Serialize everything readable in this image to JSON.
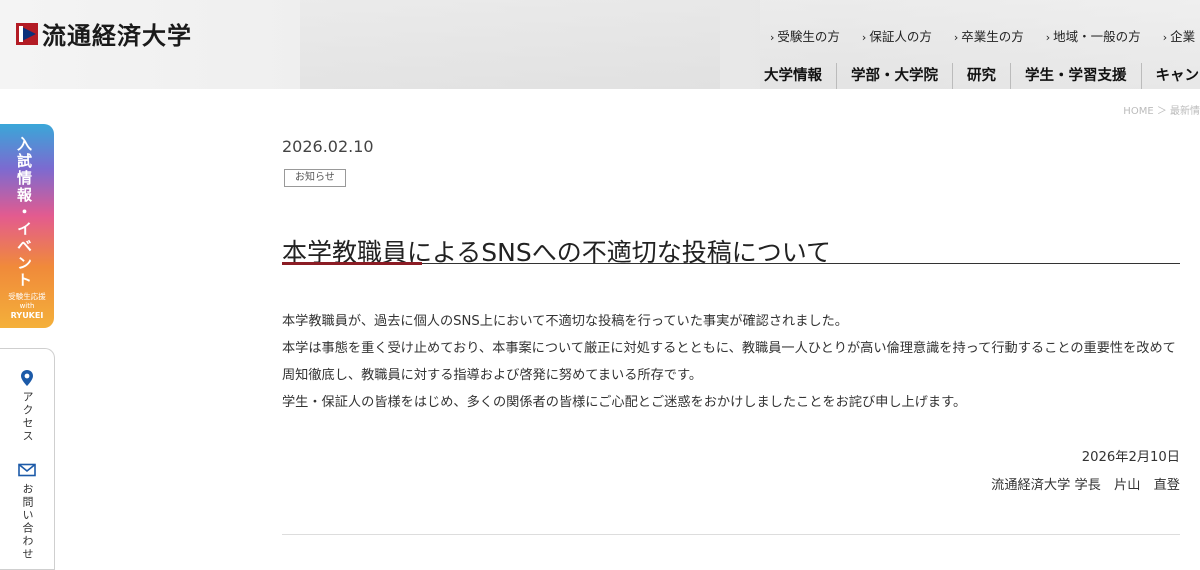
{
  "header": {
    "logo_text": "流通経済大学",
    "top_links": [
      "受験生の方",
      "保証人の方",
      "卒業生の方",
      "地域・一般の方",
      "企業・"
    ],
    "main_nav": [
      "大学情報",
      "学部・大学院",
      "研究",
      "学生・学習支援",
      "キャン"
    ]
  },
  "breadcrumb": "HOME ＞ 最新情",
  "side_tab": {
    "label": "入試情報・イベント",
    "sub_line1": "受験生応援",
    "sub_line2": "with",
    "sub_line3": "RYUKEI"
  },
  "side_panel": {
    "access_icon": "map-pin-icon",
    "access_label": "アクセス",
    "contact_icon": "mail-icon",
    "contact_label": "お問い合わせ"
  },
  "article": {
    "date": "2026.02.10",
    "category": "お知らせ",
    "title": "本学教職員によるSNSへの不適切な投稿について",
    "paragraphs": [
      "本学教職員が、過去に個人のSNS上において不適切な投稿を行っていた事実が確認されました。",
      "本学は事態を重く受け止めており、本事案について厳正に対処するとともに、教職員一人ひとりが高い倫理意識を持って行動することの重要性を改めて周知徹底し、教職員に対する指導および啓発に努めてまいる所存です。",
      "学生・保証人の皆様をはじめ、多くの関係者の皆様にご心配とご迷惑をおかけしましたことをお詫び申し上げます。"
    ],
    "sign_date": "2026年2月10日",
    "sign_name": "流通経済大学 学長　片山　直登"
  },
  "colors": {
    "accent_red": "#8b1c24",
    "logo_red": "#b31b24",
    "logo_blue": "#0a2f7a"
  }
}
